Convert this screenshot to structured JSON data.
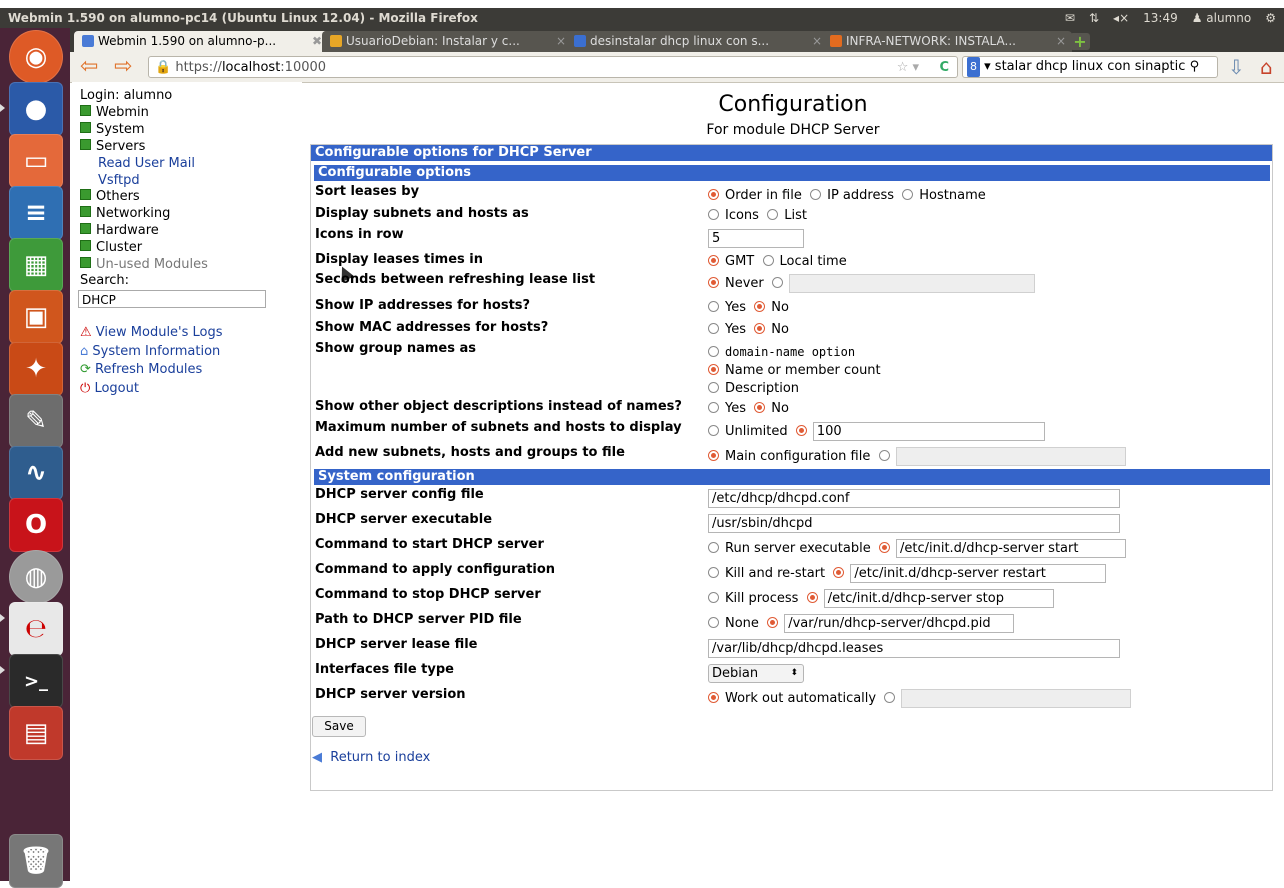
{
  "window": {
    "title": "Webmin 1.590 on alumno-pc14 (Ubuntu Linux 12.04) - Mozilla Firefox",
    "clock": "13:49",
    "user": "alumno"
  },
  "tabs": [
    {
      "label": "Webmin 1.590 on alumno-p...",
      "fav": "#4a7bd6"
    },
    {
      "label": "UsuarioDebian: Instalar y c...",
      "fav": "#e7a626"
    },
    {
      "label": "desinstalar dhcp linux con s...",
      "fav": "#3b6fd1"
    },
    {
      "label": "INFRA-NETWORK: INSTALA...",
      "fav": "#e26b1f"
    }
  ],
  "nav": {
    "url_prefix": "https://",
    "url_host": "localhost",
    "url_port": ":10000",
    "search_text": "stalar dhcp linux con sinaptic"
  },
  "sidebar": {
    "login": "Login: alumno",
    "categories": [
      "Webmin",
      "System",
      "Servers",
      "Others",
      "Networking",
      "Hardware",
      "Cluster",
      "Un-used Modules"
    ],
    "server_subitems": [
      "Read User Mail",
      "Vsftpd"
    ],
    "search_label": "Search:",
    "search_value": "DHCP",
    "links": [
      "View Module's Logs",
      "System Information",
      "Refresh Modules",
      "Logout"
    ]
  },
  "page": {
    "title": "Configuration",
    "subtitle": "For module DHCP Server",
    "section_main": "Configurable options for DHCP Server",
    "section_options": "Configurable options",
    "section_system": "System configuration",
    "save": "Save",
    "return": "Return to index"
  },
  "options": {
    "sort_leases": {
      "label": "Sort leases by",
      "choices": [
        "Order in file",
        "IP address",
        "Hostname"
      ]
    },
    "display_subnets": {
      "label": "Display subnets and hosts as",
      "choices": [
        "Icons",
        "List"
      ]
    },
    "icons_row": {
      "label": "Icons in row",
      "value": "5"
    },
    "lease_times": {
      "label": "Display leases times in",
      "choices": [
        "GMT",
        "Local time"
      ]
    },
    "refresh": {
      "label": "Seconds between refreshing lease list",
      "choice": "Never"
    },
    "show_ip": {
      "label": "Show IP addresses for hosts?",
      "choices": [
        "Yes",
        "No"
      ]
    },
    "show_mac": {
      "label": "Show MAC addresses for hosts?",
      "choices": [
        "Yes",
        "No"
      ]
    },
    "group_names": {
      "label": "Show group names as",
      "choices": [
        "domain-name option",
        "Name or member count",
        "Description"
      ]
    },
    "other_desc": {
      "label": "Show other object descriptions instead of names?",
      "choices": [
        "Yes",
        "No"
      ]
    },
    "max_subnets": {
      "label": "Maximum number of subnets and hosts to display",
      "choice": "Unlimited",
      "value": "100"
    },
    "add_new": {
      "label": "Add new subnets, hosts and groups to file",
      "choice": "Main configuration file"
    }
  },
  "system": {
    "config_file": {
      "label": "DHCP server config file",
      "value": "/etc/dhcp/dhcpd.conf"
    },
    "executable": {
      "label": "DHCP server executable",
      "value": "/usr/sbin/dhcpd"
    },
    "start_cmd": {
      "label": "Command to start DHCP server",
      "choice": "Run server executable",
      "value": "/etc/init.d/dhcp-server start"
    },
    "apply_cmd": {
      "label": "Command to apply configuration",
      "choice": "Kill and re-start",
      "value": "/etc/init.d/dhcp-server restart"
    },
    "stop_cmd": {
      "label": "Command to stop DHCP server",
      "choice": "Kill process",
      "value": "/etc/init.d/dhcp-server stop"
    },
    "pid_file": {
      "label": "Path to DHCP server PID file",
      "choice": "None",
      "value": "/var/run/dhcp-server/dhcpd.pid"
    },
    "lease_file": {
      "label": "DHCP server lease file",
      "value": "/var/lib/dhcp/dhcpd.leases"
    },
    "iface_type": {
      "label": "Interfaces file type",
      "value": "Debian"
    },
    "version": {
      "label": "DHCP server version",
      "choice": "Work out automatically"
    }
  }
}
